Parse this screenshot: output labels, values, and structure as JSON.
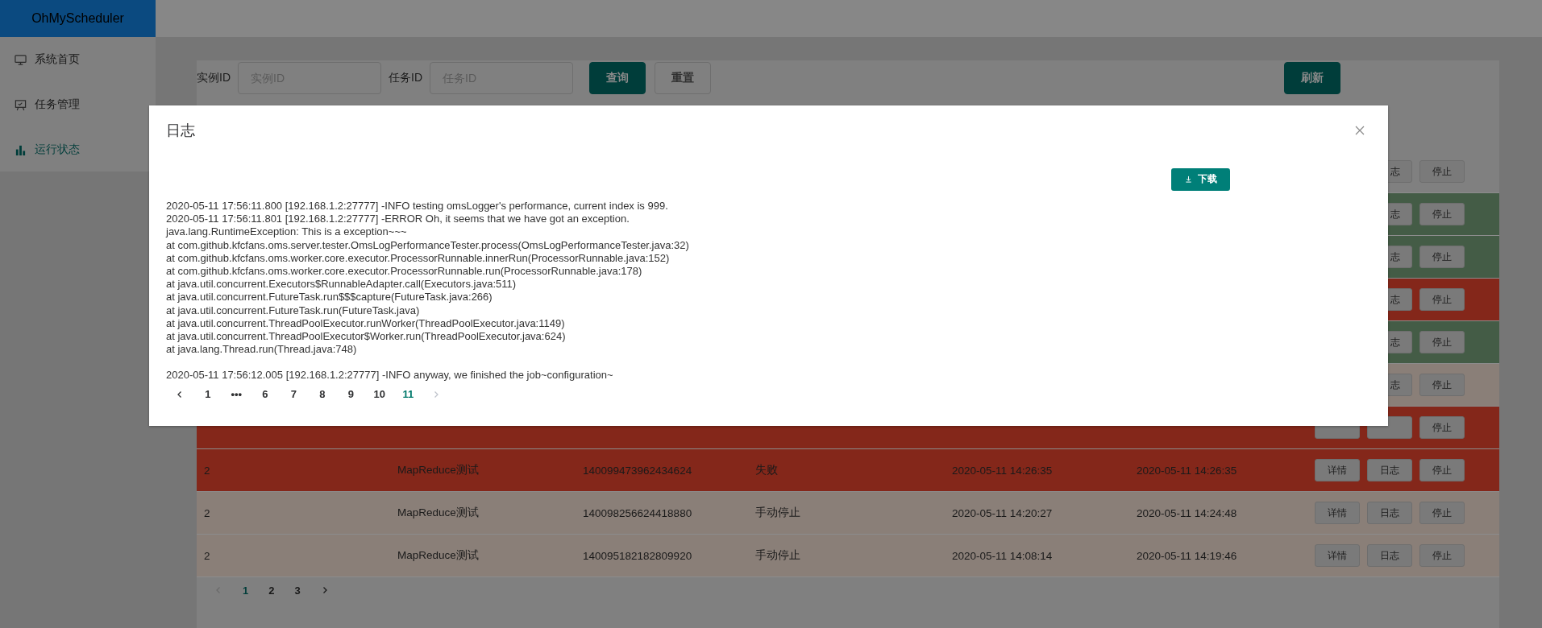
{
  "app": {
    "logo": "OhMyScheduler"
  },
  "sidebar": {
    "items": [
      {
        "label": "系统首页",
        "kind": "monitor",
        "selected": false
      },
      {
        "label": "任务管理",
        "kind": "board",
        "selected": false
      },
      {
        "label": "运行状态",
        "kind": "chart",
        "selected": true
      }
    ]
  },
  "search": {
    "fields": [
      {
        "label": "实例ID",
        "placeholder": "实例ID"
      },
      {
        "label": "任务ID",
        "placeholder": "任务ID"
      }
    ],
    "buttons": [
      {
        "label": "查询",
        "kind": "primary"
      },
      {
        "label": "重置",
        "kind": "default"
      }
    ],
    "refresh": "刷新"
  },
  "table": {
    "rows": [
      {
        "color": "#808080",
        "actions": [
          "志",
          "停止"
        ]
      },
      {
        "color": "#445c46",
        "actions": [
          "志",
          "停止"
        ]
      },
      {
        "color": "#445c46",
        "actions": [
          "志",
          "停止"
        ]
      },
      {
        "color": "#84271a",
        "actions": [
          "志",
          "停止"
        ]
      },
      {
        "color": "#445c46",
        "actions": [
          "志",
          "停止"
        ]
      },
      {
        "color": "#8a7f78",
        "actions": [
          "志",
          "停止"
        ]
      },
      {
        "color": "#84271a",
        "actions": [
          "停止"
        ]
      },
      {
        "color": "#84271a",
        "cells": [
          "2",
          "MapReduce测试",
          "140099473962434624",
          "失败",
          "2020-05-11 14:26:35",
          "2020-05-11 14:26:35"
        ],
        "actions": [
          "详情",
          "日志",
          "停止"
        ]
      },
      {
        "color": "#8a7f78",
        "cells": [
          "2",
          "MapReduce测试",
          "140098256624418880",
          "手动停止",
          "2020-05-11 14:20:27",
          "2020-05-11 14:24:48"
        ],
        "actions": [
          "详情",
          "日志",
          "停止"
        ]
      },
      {
        "color": "#8a7f78",
        "cells": [
          "2",
          "MapReduce测试",
          "140095182182809920",
          "手动停止",
          "2020-05-11 14:08:14",
          "2020-05-11 14:19:46"
        ],
        "actions": [
          "详情",
          "日志",
          "停止"
        ]
      }
    ]
  },
  "pagination": {
    "prev_disabled": true,
    "next_disabled": false,
    "pages": [
      {
        "label": "1",
        "selected": true
      },
      {
        "label": "2",
        "selected": false
      },
      {
        "label": "3",
        "selected": false
      }
    ]
  },
  "dialog": {
    "title": "日志",
    "download": "下载",
    "log": {
      "blocks": [
        {
          "lines": [
            "2020-05-11 17:56:11.800 [192.168.1.2:27777] -INFO testing omsLogger's performance, current index is 999.",
            "2020-05-11 17:56:11.801 [192.168.1.2:27777] -ERROR Oh, it seems that we have got an exception.",
            "java.lang.RuntimeException: This is a exception~~~",
            "at com.github.kfcfans.oms.server.tester.OmsLogPerformanceTester.process(OmsLogPerformanceTester.java:32)",
            "at com.github.kfcfans.oms.worker.core.executor.ProcessorRunnable.innerRun(ProcessorRunnable.java:152)",
            "at com.github.kfcfans.oms.worker.core.executor.ProcessorRunnable.run(ProcessorRunnable.java:178)",
            "at java.util.concurrent.Executors$RunnableAdapter.call(Executors.java:511)",
            "at java.util.concurrent.FutureTask.run$$$capture(FutureTask.java:266)",
            "at java.util.concurrent.FutureTask.run(FutureTask.java)",
            "at java.util.concurrent.ThreadPoolExecutor.runWorker(ThreadPoolExecutor.java:1149)",
            "at java.util.concurrent.ThreadPoolExecutor$Worker.run(ThreadPoolExecutor.java:624)",
            "at java.lang.Thread.run(Thread.java:748)"
          ]
        },
        {
          "lines": [
            "2020-05-11 17:56:12.005 [192.168.1.2:27777] -INFO anyway, we finished the job~configuration~"
          ]
        }
      ]
    },
    "pagination": {
      "prev_disabled": false,
      "next_disabled": true,
      "pages": [
        {
          "label": "1",
          "selected": false
        },
        {
          "label": "•••",
          "selected": false
        },
        {
          "label": "6",
          "selected": false
        },
        {
          "label": "7",
          "selected": false
        },
        {
          "label": "8",
          "selected": false
        },
        {
          "label": "9",
          "selected": false
        },
        {
          "label": "10",
          "selected": false
        },
        {
          "label": "11",
          "selected": true
        }
      ]
    }
  }
}
